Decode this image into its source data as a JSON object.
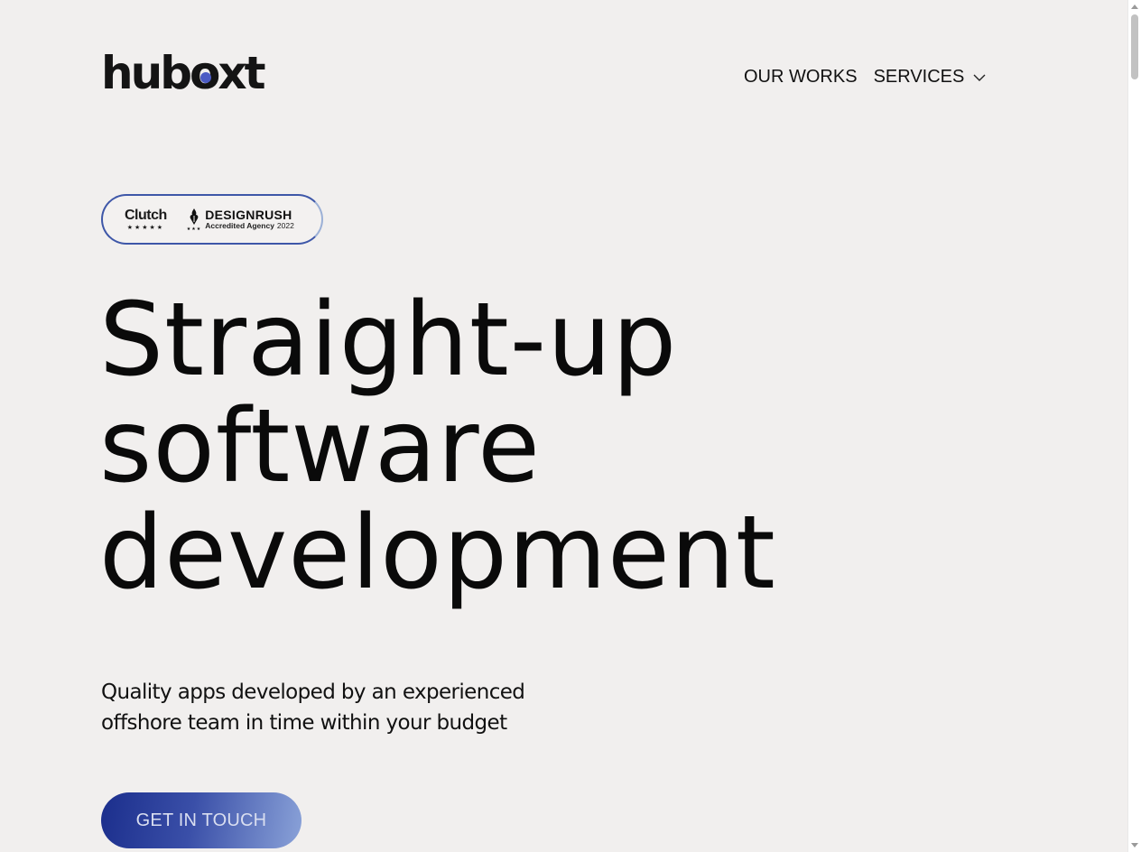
{
  "logo": {
    "part1": "hub",
    "part2": "o",
    "part3": "xt",
    "accent_color": "#4b5bc4"
  },
  "nav": {
    "items": [
      {
        "label": "OUR WORKS"
      },
      {
        "label": "SERVICES",
        "icon": "chevron-down-icon"
      }
    ]
  },
  "badges": {
    "clutch": {
      "name": "Clutch",
      "stars": "★★★★★"
    },
    "designrush": {
      "name": "DESIGNRUSH",
      "subtitle": "Accredited Agency",
      "year": "2022",
      "stars": "★★★"
    }
  },
  "hero": {
    "headline_lines": [
      "Straight-up",
      "software",
      "development"
    ],
    "subtitle_lines": [
      "Quality apps developed by an experienced",
      "offshore team in time within your budget"
    ],
    "cta_label": "GET IN TOUCH"
  },
  "colors": {
    "background": "#f1efee",
    "cta_gradient_start": "#1b2e8c",
    "cta_gradient_end": "#8aa2d8",
    "badge_border": "#3e57a8"
  }
}
